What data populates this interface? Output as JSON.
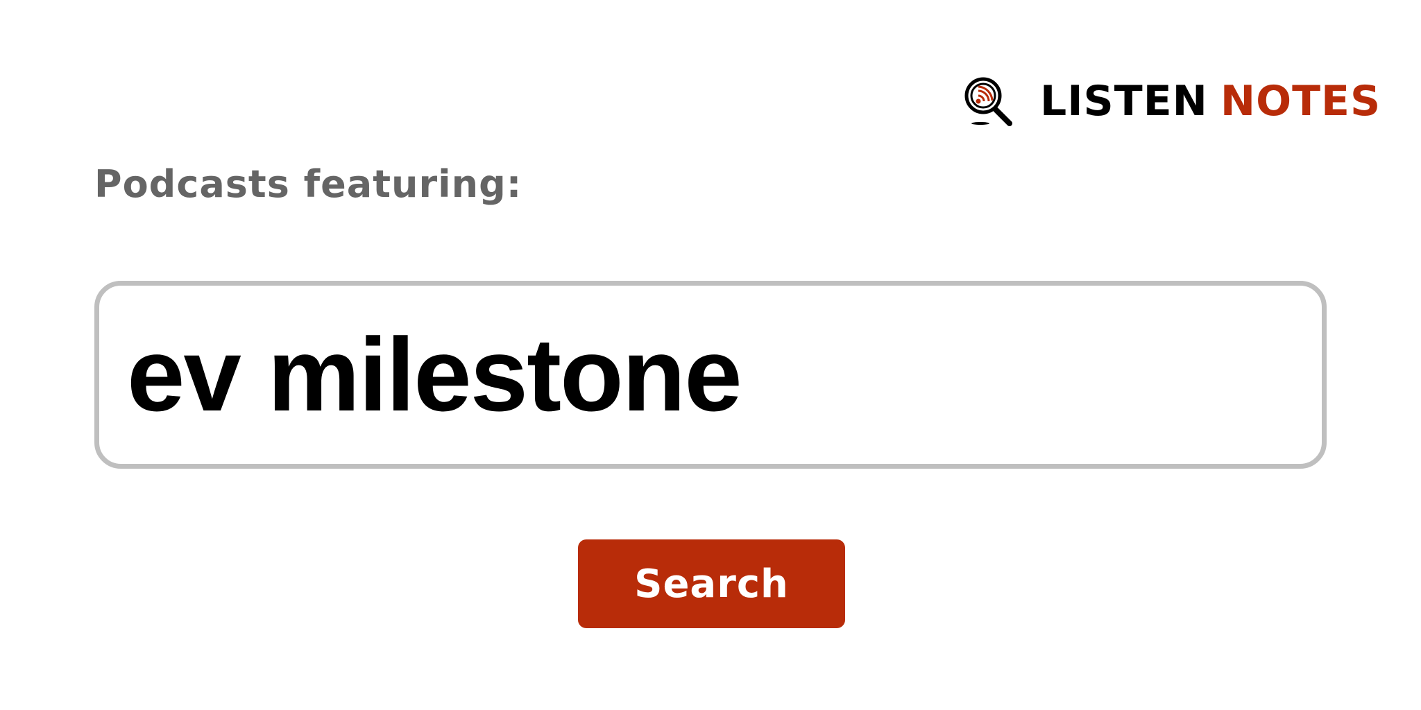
{
  "logo": {
    "icon": "podcast-search-icon",
    "word1": "LISTEN",
    "word2": "NOTES",
    "color_primary": "#000000",
    "color_accent": "#b82c09"
  },
  "subtitle": "Podcasts featuring:",
  "search": {
    "value": "ev milestone"
  },
  "button": {
    "label": "Search",
    "color": "#b82c09"
  }
}
